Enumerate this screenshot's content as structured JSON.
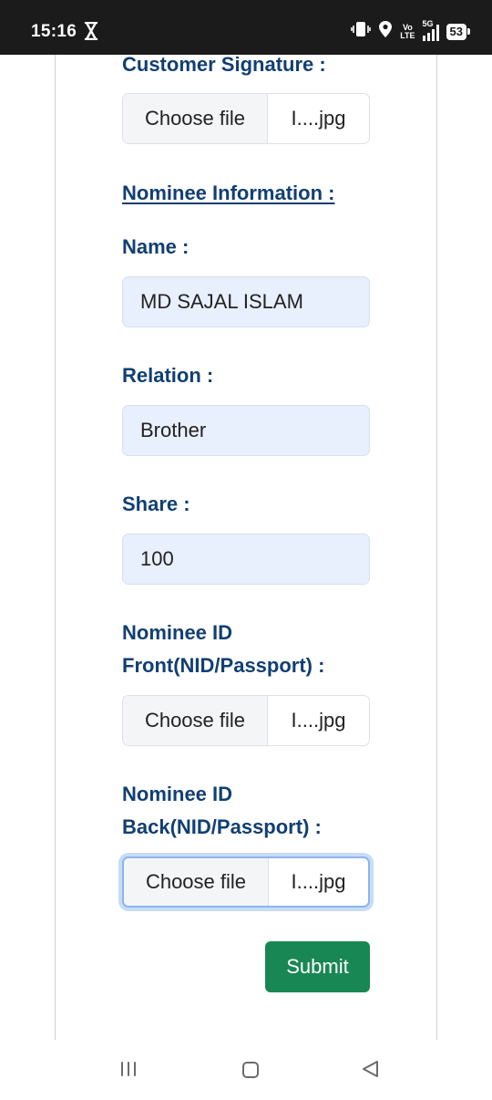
{
  "status_bar": {
    "time": "15:16",
    "volte_top": "Vo",
    "volte_bottom": "LTE",
    "network": "5G",
    "battery": "53",
    "icons": [
      "hourglass-icon",
      "vibrate-icon",
      "location-icon",
      "signal-icon",
      "battery-icon"
    ]
  },
  "form": {
    "customer_signature": {
      "label": "Customer Signature :",
      "button": "Choose file",
      "file_name": "I....jpg"
    },
    "nominee_section_title": "Nominee Information :",
    "name": {
      "label": "Name :",
      "value": "MD SAJAL ISLAM"
    },
    "relation": {
      "label": "Relation :",
      "value": "Brother"
    },
    "share": {
      "label": "Share :",
      "value": "100"
    },
    "nominee_id_front": {
      "label_line1": "Nominee ID",
      "label_line2": "Front(NID/Passport) :",
      "button": "Choose file",
      "file_name": "I....jpg"
    },
    "nominee_id_back": {
      "label_line1": "Nominee ID",
      "label_line2": "Back(NID/Passport) :",
      "button": "Choose file",
      "file_name": "I....jpg"
    },
    "submit_label": "Submit"
  },
  "nav_bar": {
    "icons": [
      "menu-icon",
      "home-icon",
      "back-icon"
    ]
  },
  "colors": {
    "label": "#123f72",
    "input_bg": "#e8effd",
    "submit_bg": "#198754",
    "status_bar_bg": "#1b1b1b"
  }
}
